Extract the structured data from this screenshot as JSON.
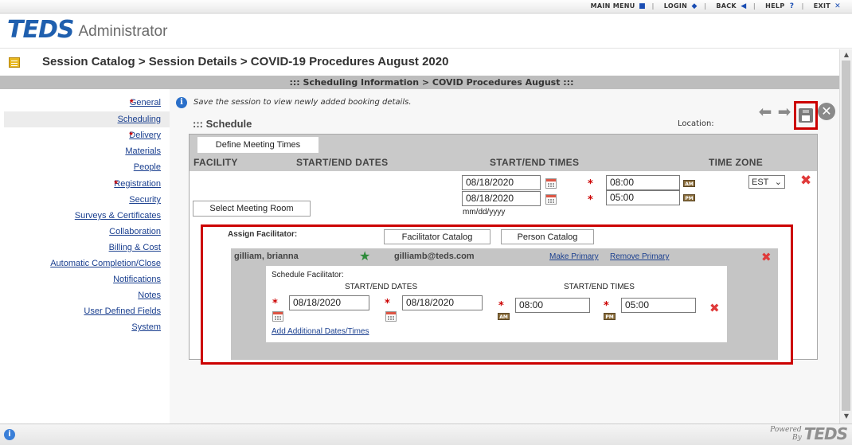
{
  "topnav": [
    {
      "label": "MAIN MENU",
      "icon": "square-icon"
    },
    {
      "label": "LOGIN",
      "icon": "diamond-icon"
    },
    {
      "label": "BACK",
      "icon": "triangle-left-icon"
    },
    {
      "label": "HELP",
      "icon": "question-icon"
    },
    {
      "label": "EXIT",
      "icon": "x-icon"
    }
  ],
  "header": {
    "brand": "TEDS",
    "app": "Administrator"
  },
  "breadcrumb": "Session Catalog > Session Details > COVID-19 Procedures August 2020",
  "subheader": "::: Scheduling Information > COVID Procedures August :::",
  "sidebar": {
    "items": [
      {
        "label": "General",
        "required": true
      },
      {
        "label": "Scheduling",
        "required": false,
        "active": true
      },
      {
        "label": "Delivery",
        "required": true
      },
      {
        "label": "Materials",
        "required": false
      },
      {
        "label": "People",
        "required": false
      },
      {
        "label": "Registration",
        "required": true
      },
      {
        "label": "Security",
        "required": false
      },
      {
        "label": "Surveys & Certificates",
        "required": false
      },
      {
        "label": "Collaboration",
        "required": false
      },
      {
        "label": "Billing & Cost",
        "required": false
      },
      {
        "label": "Automatic Completion/Close",
        "required": false
      },
      {
        "label": "Notifications",
        "required": false
      },
      {
        "label": "Notes",
        "required": false
      },
      {
        "label": "User Defined Fields",
        "required": false
      },
      {
        "label": "System",
        "required": false
      }
    ]
  },
  "main": {
    "info": "Save the session to view newly added booking details.",
    "schedule_title": "::: Schedule",
    "location_label": "Location:",
    "define_meeting_btn": "Define Meeting Times",
    "columns": {
      "facility": "FACILITY",
      "dates": "START/END DATES",
      "times": "START/END TIMES",
      "timezone": "TIME ZONE"
    },
    "start_date": "08/18/2020",
    "end_date": "08/18/2020",
    "date_format": "mm/dd/yyyy",
    "start_time": "08:00",
    "end_time": "05:00",
    "am": "AM",
    "pm": "PM",
    "timezone": "EST",
    "select_room_btn": "Select Meeting Room",
    "facilitator": {
      "assign_label": "Assign Facilitator:",
      "catalog_btn": "Facilitator Catalog",
      "person_btn": "Person Catalog",
      "name": "gilliam, brianna",
      "email": "gilliamb@teds.com",
      "make_primary": "Make Primary",
      "remove_primary": "Remove Primary",
      "schedule_label": "Schedule Facilitator:",
      "dates_header": "START/END DATES",
      "times_header": "START/END TIMES",
      "start_date": "08/18/2020",
      "end_date": "08/18/2020",
      "start_time": "08:00",
      "end_time": "05:00",
      "add_link": "Add Additional Dates/Times"
    }
  },
  "footer": {
    "powered": "Powered",
    "by": "By",
    "logo": "TEDS"
  },
  "colors": {
    "accent": "#1f5fae",
    "highlight": "#cc0000",
    "required": "#cc0000"
  }
}
